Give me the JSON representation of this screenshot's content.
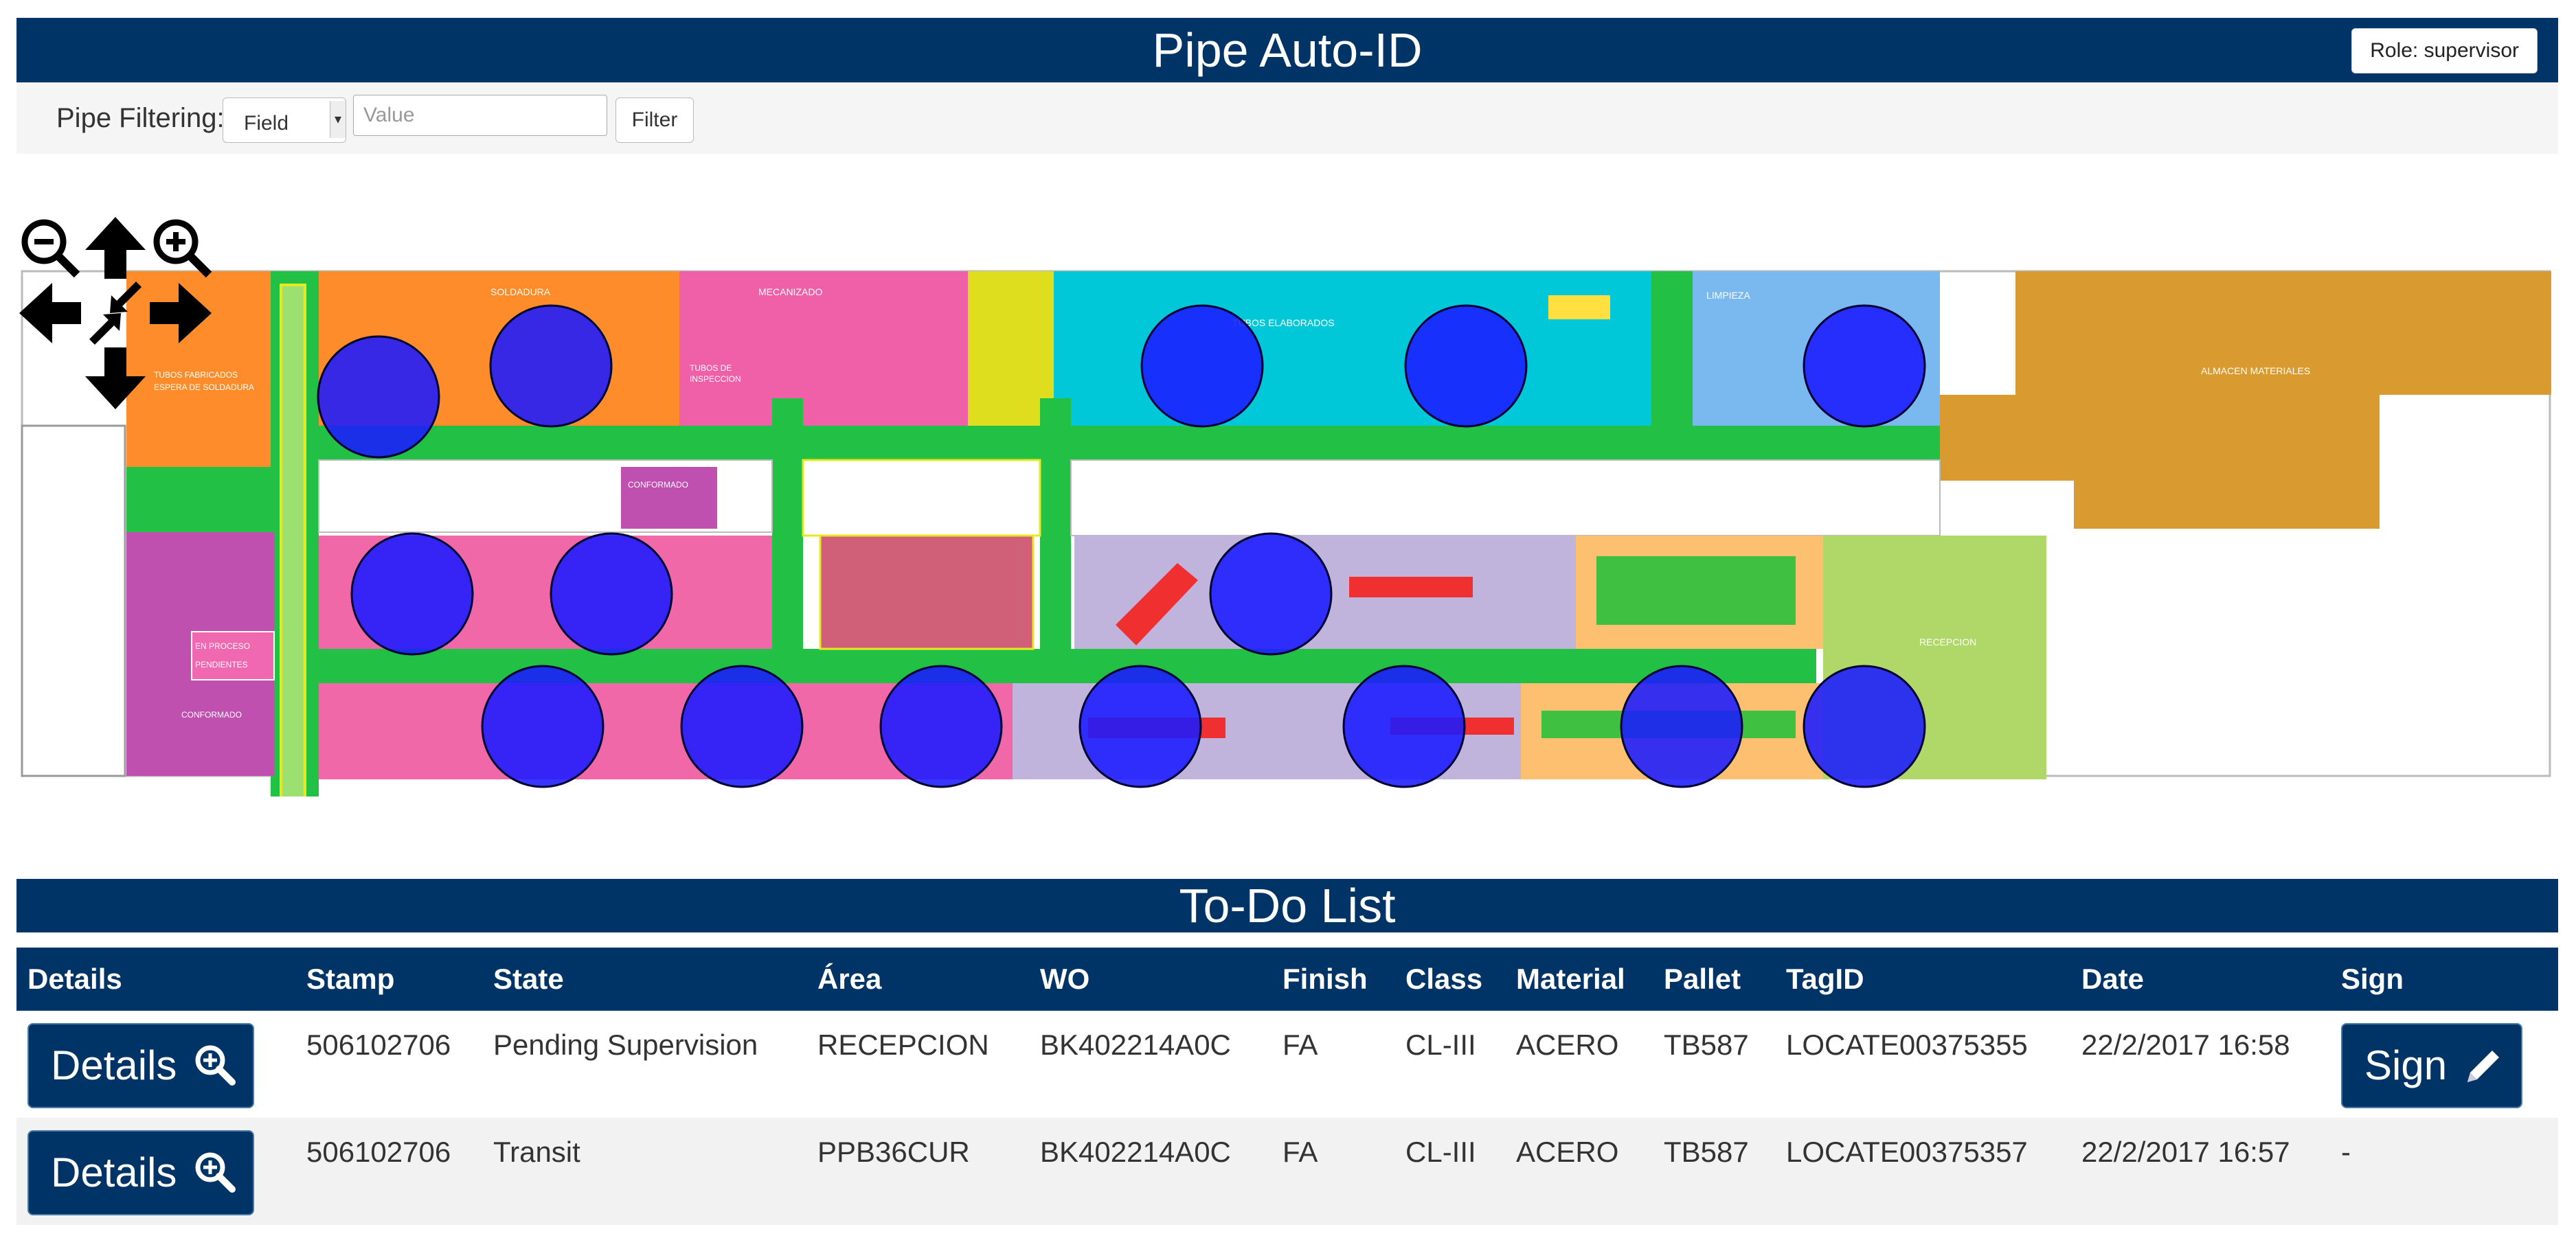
{
  "header": {
    "title": "Pipe Auto-ID",
    "role_label": "Role: supervisor"
  },
  "filter": {
    "label": "Pipe Filtering:",
    "field_selected": "Field",
    "value_placeholder": "Value",
    "button_label": "Filter"
  },
  "map": {
    "area_labels": {
      "soldadura": "SOLDADURA",
      "mecanizado": "MECANIZADO",
      "tubos_fabricados": "TUBOS FABRICADOS",
      "tubos_fabricados_2": "ESPERA DE SOLDADURA",
      "tubos_inspeccion": "TUBOS DE",
      "tubos_inspeccion_2": "INSPECCION",
      "tubos_elaborados": "TUBOS ELABORADOS",
      "limpieza": "LIMPIEZA",
      "almacen": "ALMACEN MATERIALES",
      "conformado_top": "CONFORMADO",
      "conformado_bottom": "CONFORMADO",
      "en_proceso": "EN PROCESO",
      "pendientes": "PENDIENTES",
      "recepcion": "RECEPCION"
    },
    "marker_color": "#1a1aff"
  },
  "todo": {
    "title": "To-Do List",
    "columns": [
      "Details",
      "Stamp",
      "State",
      "Área",
      "WO",
      "Finish",
      "Class",
      "Material",
      "Pallet",
      "TagID",
      "Date",
      "Sign"
    ],
    "rows": [
      {
        "details_label": "Details",
        "stamp": "506102706",
        "state": "Pending Supervision",
        "area": "RECEPCION",
        "wo": "BK402214A0C",
        "finish": "FA",
        "class": "CL-III",
        "material": "ACERO",
        "pallet": "TB587",
        "tagid": "LOCATE00375355",
        "date": "22/2/2017 16:58",
        "sign": "Sign"
      },
      {
        "details_label": "Details",
        "stamp": "506102706",
        "state": "Transit",
        "area": "PPB36CUR",
        "wo": "BK402214A0C",
        "finish": "FA",
        "class": "CL-III",
        "material": "ACERO",
        "pallet": "TB587",
        "tagid": "LOCATE00375357",
        "date": "22/2/2017 16:57",
        "sign": "-"
      }
    ]
  }
}
